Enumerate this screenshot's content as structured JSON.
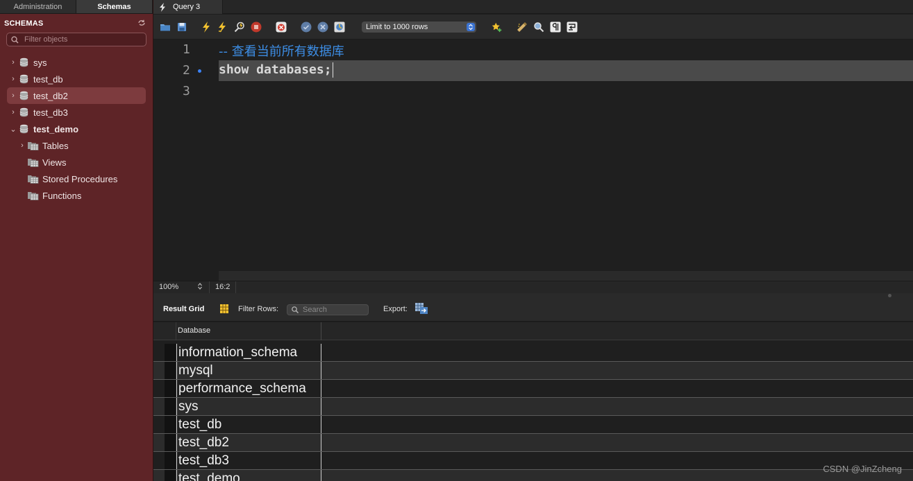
{
  "sidebar": {
    "tabs": [
      "Administration",
      "Schemas"
    ],
    "active_tab": "Schemas",
    "header": "SCHEMAS",
    "filter_placeholder": "Filter objects",
    "tree": [
      {
        "label": "sys",
        "level": 0,
        "expander": "›",
        "icon": "database-icon",
        "selected": false,
        "bold": false
      },
      {
        "label": "test_db",
        "level": 0,
        "expander": "›",
        "icon": "database-icon",
        "selected": false,
        "bold": false
      },
      {
        "label": "test_db2",
        "level": 0,
        "expander": "›",
        "icon": "database-icon",
        "selected": true,
        "bold": false
      },
      {
        "label": "test_db3",
        "level": 0,
        "expander": "›",
        "icon": "database-icon",
        "selected": false,
        "bold": false
      },
      {
        "label": "test_demo",
        "level": 0,
        "expander": "⌄",
        "icon": "database-icon",
        "selected": false,
        "bold": true
      },
      {
        "label": "Tables",
        "level": 1,
        "expander": "›",
        "icon": "table-folder-icon",
        "selected": false,
        "bold": false
      },
      {
        "label": "Views",
        "level": 1,
        "expander": "",
        "icon": "view-folder-icon",
        "selected": false,
        "bold": false
      },
      {
        "label": "Stored Procedures",
        "level": 1,
        "expander": "",
        "icon": "procedure-folder-icon",
        "selected": false,
        "bold": false
      },
      {
        "label": "Functions",
        "level": 1,
        "expander": "",
        "icon": "function-folder-icon",
        "selected": false,
        "bold": false
      }
    ]
  },
  "query_tab": {
    "label": "Query 3",
    "icon": "lightning-icon"
  },
  "toolbar": {
    "limit_select": "Limit to 1000 rows",
    "icons": [
      "open-file-icon",
      "save-icon",
      "execute-icon",
      "execute-current-icon",
      "explain-icon",
      "stop-icon",
      "toggle-error-icon",
      "commit-icon",
      "rollback-icon",
      "autocommit-icon",
      "bookmark-icon",
      "beautify-icon",
      "find-icon",
      "invisible-chars-icon",
      "wrap-lines-icon"
    ]
  },
  "editor": {
    "line_numbers": [
      "1",
      "2",
      "3"
    ],
    "line1": "-- 查看当前所有数据库",
    "line2": "show databases;"
  },
  "statusbar": {
    "zoom": "100%",
    "cursor": "16:2"
  },
  "result": {
    "grid_label": "Result Grid",
    "filter_label": "Filter Rows:",
    "search_placeholder": "Search",
    "export_label": "Export:",
    "column": "Database",
    "rows": [
      "information_schema",
      "mysql",
      "performance_schema",
      "sys",
      "test_db",
      "test_db2",
      "test_db3",
      "test_demo"
    ]
  },
  "watermark": "CSDN @JinZcheng",
  "colors": {
    "sidebar_bg": "#5e2427",
    "comment": "#3d8ee6",
    "accent": "#3b73d1"
  }
}
